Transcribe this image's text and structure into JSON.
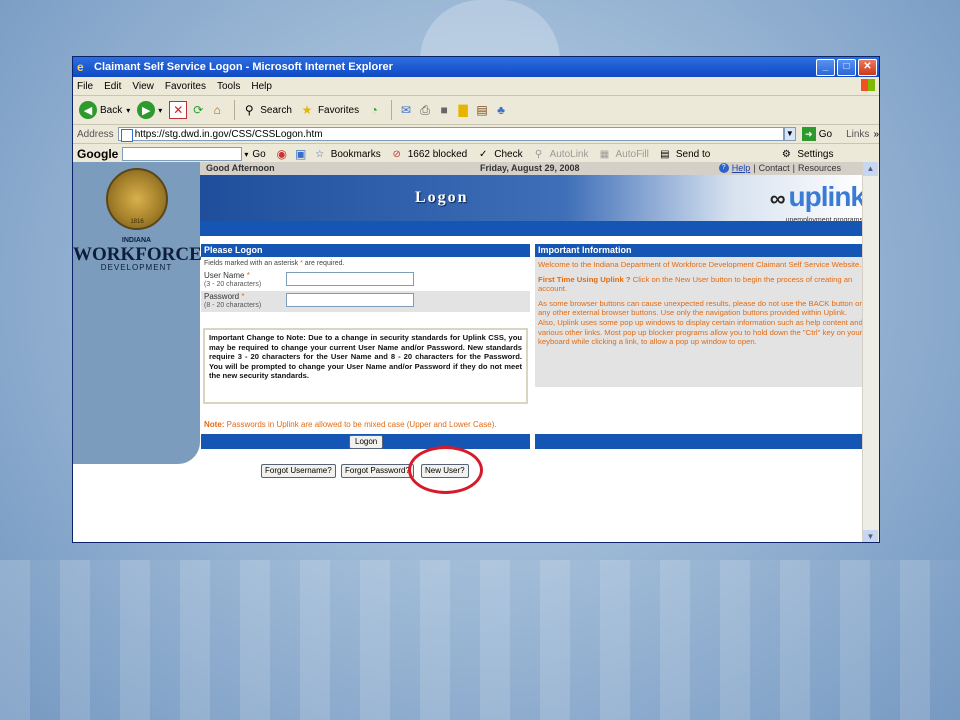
{
  "window": {
    "title": "Claimant Self Service Logon - Microsoft Internet Explorer",
    "buttons": {
      "minimize": "_",
      "maximize": "□",
      "close": "✕"
    }
  },
  "menu": [
    "File",
    "Edit",
    "View",
    "Favorites",
    "Tools",
    "Help"
  ],
  "toolbar": {
    "back": "Back",
    "search": "Search",
    "favorites": "Favorites"
  },
  "address": {
    "label": "Address",
    "url": "https://stg.dwd.in.gov/CSS/CSSLogon.htm",
    "go": "Go",
    "links": "Links"
  },
  "googlebar": {
    "logo": "Google",
    "go": "Go",
    "bookmarks": "Bookmarks",
    "blocked": "1662 blocked",
    "check": "Check",
    "autolink": "AutoLink",
    "autofill": "AutoFill",
    "sendto": "Send to",
    "settings": "Settings"
  },
  "page": {
    "greeting": "Good Afternoon",
    "date": "Friday, August 29, 2008",
    "help": "Help",
    "contact": "Contact",
    "resources": "Resources",
    "banner_title": "Logon",
    "brand": "uplink",
    "brand_sub": "unemployment programs",
    "org_indiana": "INDIANA",
    "org_workforce": "WORKFORCE",
    "org_development": "DEVELOPMENT",
    "seal_year": "1816"
  },
  "form": {
    "heading": "Please Logon",
    "required_note_pre": "Fields marked with an asterisk ",
    "required_star": "*",
    "required_note_post": " are required.",
    "username_label": "User Name ",
    "username_hint": "(3 - 20 characters)",
    "password_label": "Password ",
    "password_hint": "(8 - 20 characters)",
    "notice": "Important Change to Note: Due to a change in security standards for Uplink CSS, you may be required to change your current User Name and/or Password. New standards require 3 - 20 characters for the User Name and 8 - 20 characters for the Password. You will be prompted to change your User Name and/or Password if they do not meet the new security standards.",
    "pw_note_label": "Note:",
    "pw_note": " Passwords in Uplink are allowed to be mixed case (Upper and Lower Case).",
    "logon_button": "Logon"
  },
  "info": {
    "heading": "Important Information",
    "p1": "Welcome to the Indiana Department of Workforce Development Claimant Self Service Website.",
    "p2_bold": "First Time Using Uplink ?",
    "p2": " Click on the New User button to begin the process of creating an account.",
    "p3": "As some browser buttons can cause unexpected results, please do not use the BACK button or any other external browser buttons. Use only the navigation buttons provided within Uplink. Also, Uplink uses some pop up windows to display certain information such as help content and various other links. Most pop up blocker programs allow you to hold down the \"Ctrl\" key on your keyboard while clicking a link, to allow a pop up window to open."
  },
  "bottom_buttons": {
    "forgot_username": "Forgot Username?",
    "forgot_password": "Forgot Password?",
    "new_user": "New User?"
  },
  "colors": {
    "accent_blue": "#1555b3",
    "orange_text": "#e36b12",
    "highlight_red": "#d8192a"
  }
}
